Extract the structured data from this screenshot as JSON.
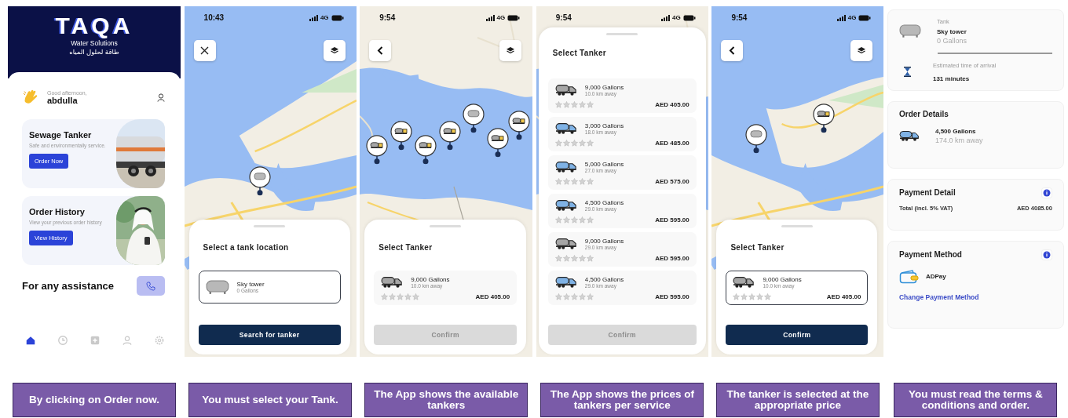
{
  "screens": [
    {
      "kind": "home",
      "logo": {
        "wordmark": "TAQA",
        "subtitle": "Water Solutions",
        "arabic": "طاقة لحلول المياه"
      },
      "greeting": "Good afternoon,",
      "user": "abdulla",
      "cards": [
        {
          "title": "Sewage Tanker",
          "text": "Safe and environmentally service.",
          "button": "Order Now"
        },
        {
          "title": "Order History",
          "text": "View your previous order history",
          "button": "View History"
        }
      ],
      "assistance": "For any assistance",
      "nav": [
        {
          "selected": true
        },
        {
          "selected": false
        },
        {
          "selected": false
        },
        {
          "selected": false
        },
        {
          "selected": false
        }
      ]
    },
    {
      "kind": "map",
      "time": "10:43",
      "network": "4G",
      "top_button": {
        "kind": "close"
      },
      "layers_button": true,
      "pins": [
        {
          "kind": "tank"
        }
      ],
      "sheet": {
        "expanded": false,
        "title": "Select a tank location",
        "items": [
          {
            "kind": "tank",
            "name": "Sky tower",
            "amount": "0 Gallons",
            "selected": true
          }
        ],
        "button": {
          "label": "Search for tanker",
          "disabled": false
        }
      }
    },
    {
      "kind": "map",
      "time": "9:54",
      "network": "4G",
      "top_button": {
        "kind": "back"
      },
      "layers_button": true,
      "pins": [
        {
          "kind": "tanker"
        },
        {
          "kind": "tanker"
        },
        {
          "kind": "tanker"
        },
        {
          "kind": "tanker"
        },
        {
          "kind": "tank"
        },
        {
          "kind": "tanker"
        },
        {
          "kind": "tanker"
        }
      ],
      "sheet": {
        "expanded": false,
        "title": "Select Tanker",
        "items": [
          {
            "kind": "tanker",
            "amount": "9,000 Gallons",
            "distance": "10.0 km away",
            "stars": 0,
            "price": "AED 405.00",
            "color": "#a6a6a6",
            "selected": false
          }
        ],
        "button": {
          "label": "Confirm",
          "disabled": true
        }
      }
    },
    {
      "kind": "map",
      "time": "9:54",
      "network": "4G",
      "sheet": {
        "expanded": true,
        "title": "Select Tanker",
        "items": [
          {
            "kind": "tanker",
            "amount": "9,000 Gallons",
            "distance": "10.0 km away",
            "stars": 0,
            "price": "AED 405.00",
            "color": "#a6a6a6",
            "selected": false
          },
          {
            "kind": "tanker",
            "amount": "3,000 Gallons",
            "distance": "18.0 km away",
            "stars": 0,
            "price": "AED 485.00",
            "color": "#7fb2e5",
            "selected": false
          },
          {
            "kind": "tanker",
            "amount": "5,000 Gallons",
            "distance": "27.0 km away",
            "stars": 0,
            "price": "AED 575.00",
            "color": "#7fb2e5",
            "selected": false
          },
          {
            "kind": "tanker",
            "amount": "4,500 Gallons",
            "distance": "29.0 km away",
            "stars": 0,
            "price": "AED 595.00",
            "color": "#7fb2e5",
            "selected": false
          },
          {
            "kind": "tanker",
            "amount": "9,000 Gallons",
            "distance": "29.0 km away",
            "stars": 0,
            "price": "AED 595.00",
            "color": "#a6a6a6",
            "selected": false
          },
          {
            "kind": "tanker",
            "amount": "4,500 Gallons",
            "distance": "29.0 km away",
            "stars": 0,
            "price": "AED 595.00",
            "color": "#7fb2e5",
            "selected": false
          }
        ],
        "button": {
          "label": "Confirm",
          "disabled": true
        }
      }
    },
    {
      "kind": "map",
      "time": "9:54",
      "network": "4G",
      "top_button": {
        "kind": "back"
      },
      "layers_button": true,
      "pins": [
        {
          "kind": "tank"
        },
        {
          "kind": "tanker"
        }
      ],
      "sheet": {
        "expanded": false,
        "title": "Select Tanker",
        "items": [
          {
            "kind": "tanker",
            "amount": "9,000 Gallons",
            "distance": "10.0 km away",
            "stars": 0,
            "price": "AED 405.00",
            "color": "#a6a6a6",
            "selected": true
          }
        ],
        "button": {
          "label": "Confirm",
          "disabled": false
        }
      }
    },
    {
      "kind": "summary",
      "tank": {
        "label": "Tank",
        "name": "Sky tower",
        "amount": "0 Gallons"
      },
      "eta": {
        "label": "Estimated time of arrival",
        "value": "131 minutes"
      },
      "order": {
        "title": "Order Details",
        "amount": "4,500 Gallons",
        "distance": "174.0 km away",
        "color": "#7fb2e5"
      },
      "payment_detail": {
        "title": "Payment Detail",
        "label": "Total (incl. 5% VAT)",
        "value": "AED 4085.00"
      },
      "payment_method": {
        "title": "Payment Method",
        "name": "ADPay",
        "link": "Change Payment Method"
      }
    }
  ],
  "captions": [
    "By clicking on Order now.",
    "You must select your Tank.",
    "The App shows the available tankers",
    "The App shows the prices of tankers per service",
    "The tanker is selected at the appropriate price",
    "You must read the terms & conditions and order."
  ]
}
